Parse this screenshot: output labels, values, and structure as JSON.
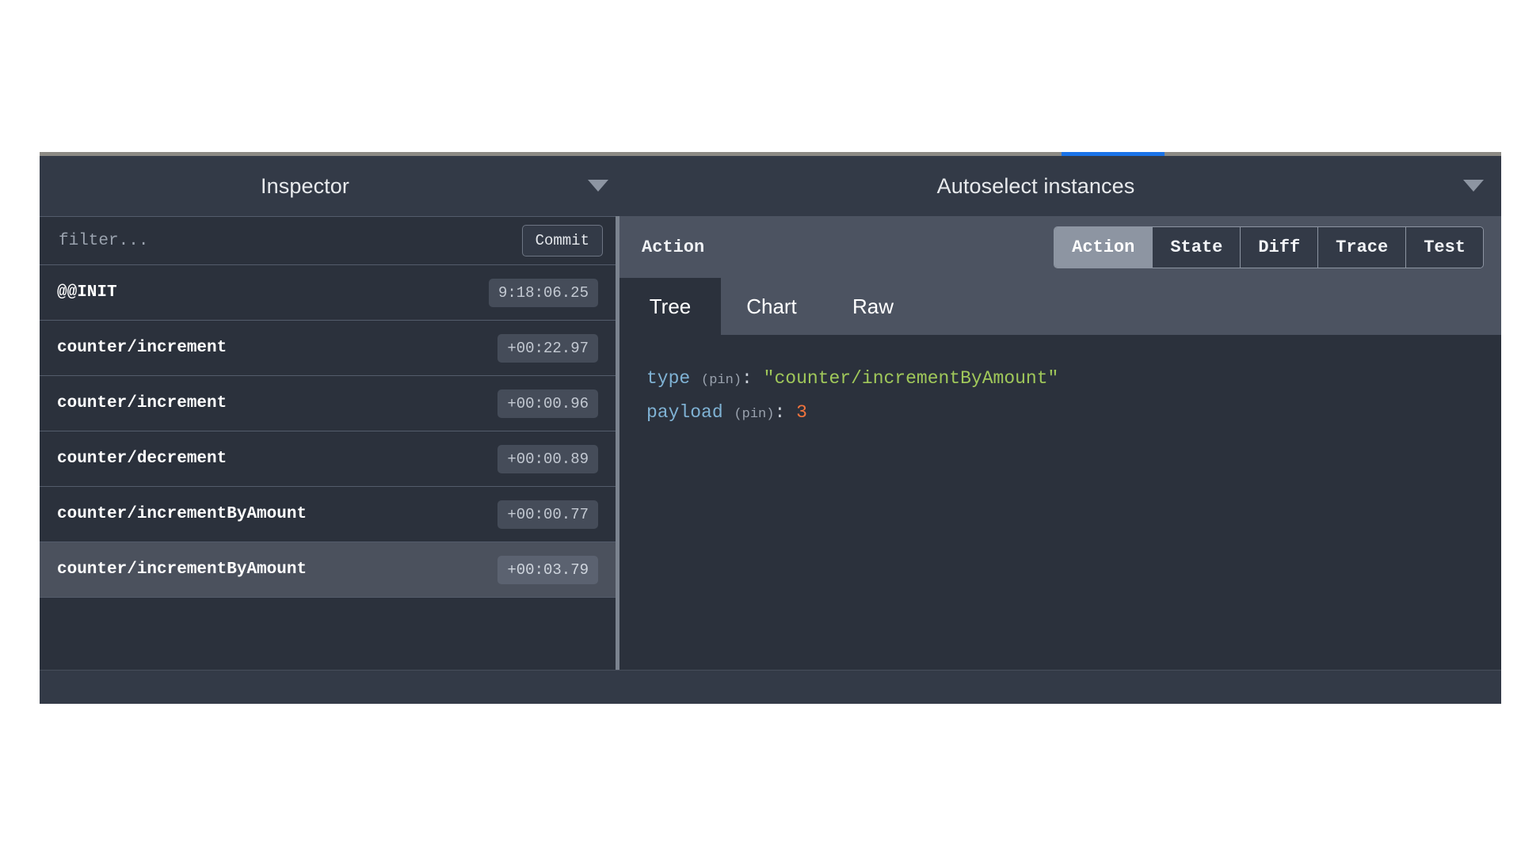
{
  "window": {
    "accent_color": "#1a73e8",
    "background": "#2f3541"
  },
  "header": {
    "inspector_title": "Inspector",
    "inspector_caret": "chevron-down-icon",
    "instances_title": "Autoselect instances",
    "instances_caret": "chevron-down-icon"
  },
  "left_pane": {
    "filter_placeholder": "filter...",
    "filter_value": "",
    "commit_label": "Commit",
    "actions": [
      {
        "name": "@@INIT",
        "time": "9:18:06.25",
        "selected": false
      },
      {
        "name": "counter/increment",
        "time": "+00:22.97",
        "selected": false
      },
      {
        "name": "counter/increment",
        "time": "+00:00.96",
        "selected": false
      },
      {
        "name": "counter/decrement",
        "time": "+00:00.89",
        "selected": false
      },
      {
        "name": "counter/incrementByAmount",
        "time": "+00:00.77",
        "selected": false
      },
      {
        "name": "counter/incrementByAmount",
        "time": "+00:03.79",
        "selected": true
      }
    ]
  },
  "right_pane": {
    "monitor_label": "Action",
    "tabs": [
      {
        "label": "Action",
        "active": true
      },
      {
        "label": "State",
        "active": false
      },
      {
        "label": "Diff",
        "active": false
      },
      {
        "label": "Trace",
        "active": false
      },
      {
        "label": "Test",
        "active": false
      }
    ],
    "subtabs": [
      {
        "label": "Tree",
        "active": true
      },
      {
        "label": "Chart",
        "active": false
      },
      {
        "label": "Raw",
        "active": false
      }
    ],
    "tree": [
      {
        "key": "type",
        "pin": "(pin)",
        "separator": ":",
        "value": "\"counter/incrementByAmount\"",
        "value_kind": "string"
      },
      {
        "key": "payload",
        "pin": "(pin)",
        "separator": ":",
        "value": "3",
        "value_kind": "number"
      }
    ]
  },
  "colors": {
    "key": "#7fb2d4",
    "string": "#a0c85a",
    "number": "#f2743d",
    "pin": "#9aa2ae",
    "selected_row": "#4b515d"
  }
}
